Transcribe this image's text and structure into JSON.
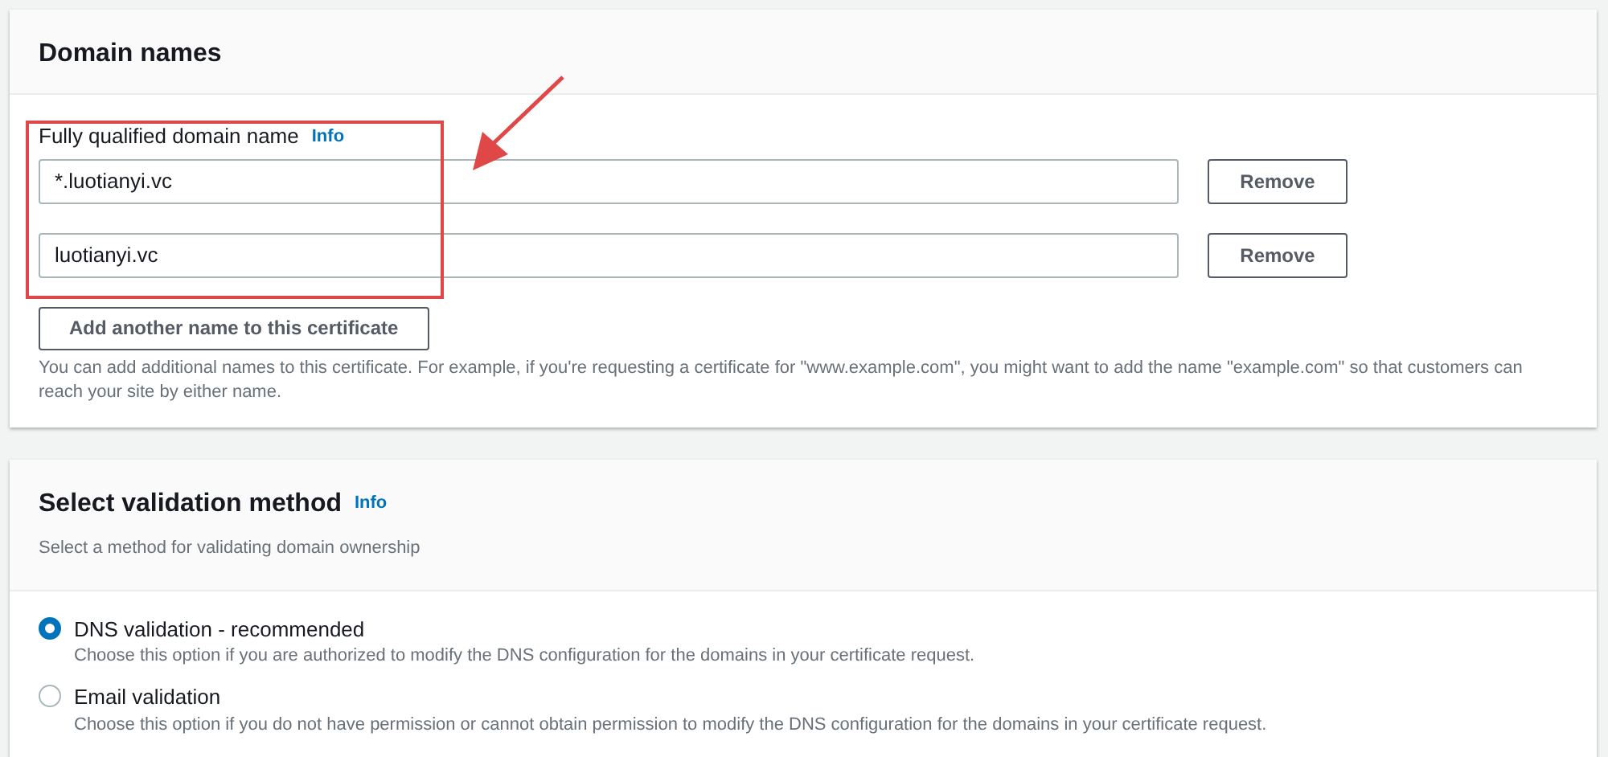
{
  "domain_names": {
    "title": "Domain names",
    "field_label": "Fully qualified domain name",
    "info_link": "Info",
    "names": [
      {
        "value": "*.luotianyi.vc",
        "remove_button": "Remove"
      },
      {
        "value": "luotianyi.vc",
        "remove_button": "Remove"
      }
    ],
    "add_button": "Add another name to this certificate",
    "help_text": "You can add additional names to this certificate. For example, if you're requesting a certificate for \"www.example.com\", you might want to add the name \"example.com\" so that customers can reach your site by either name."
  },
  "validation": {
    "title": "Select validation method",
    "info_link": "Info",
    "subtitle": "Select a method for validating domain ownership",
    "options": [
      {
        "label": "DNS validation - recommended",
        "description": "Choose this option if you are authorized to modify the DNS configuration for the domains in your certificate request.",
        "selected": true
      },
      {
        "label": "Email validation",
        "description": "Choose this option if you do not have permission or cannot obtain permission to modify the DNS configuration for the domains in your certificate request.",
        "selected": false
      }
    ]
  }
}
